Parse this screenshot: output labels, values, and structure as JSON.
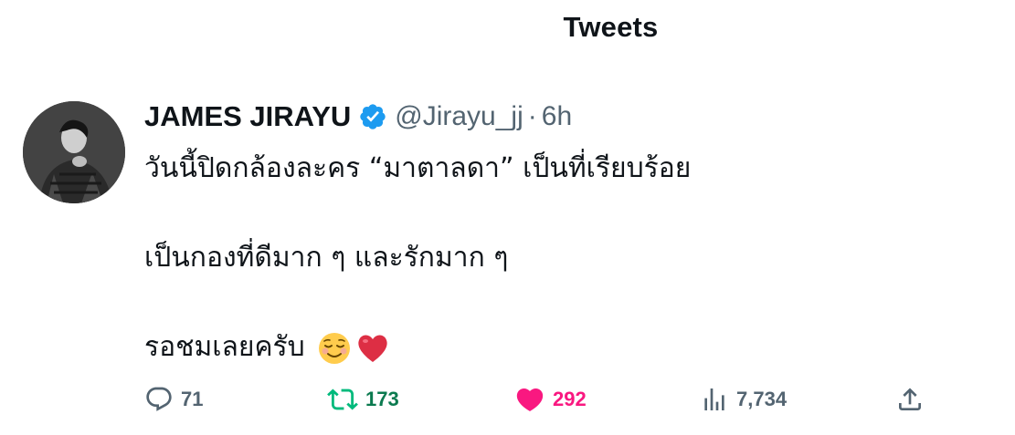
{
  "header": {
    "title": "Tweets"
  },
  "tweet": {
    "author_name": "JAMES JIRAYU",
    "handle": "@Jirayu_jj",
    "separator": "·",
    "time": "6h",
    "lines": [
      "วันนี้ปิดกล้องละคร “มาตาลดา” เป็นที่เรียบร้อย",
      "",
      "เป็นกองที่ดีมาก ๆ และรักมาก ๆ",
      "",
      "รอชมเลยครับ"
    ],
    "emojis": [
      "smiling-face-emoji",
      "red-heart-emoji"
    ]
  },
  "actions": {
    "replies": "71",
    "retweets": "173",
    "likes": "292",
    "views": "7,734"
  },
  "colors": {
    "verified": "#1d9bf0",
    "retweet_active": "#00ba7c",
    "like_active": "#f91880",
    "muted": "#536471"
  }
}
